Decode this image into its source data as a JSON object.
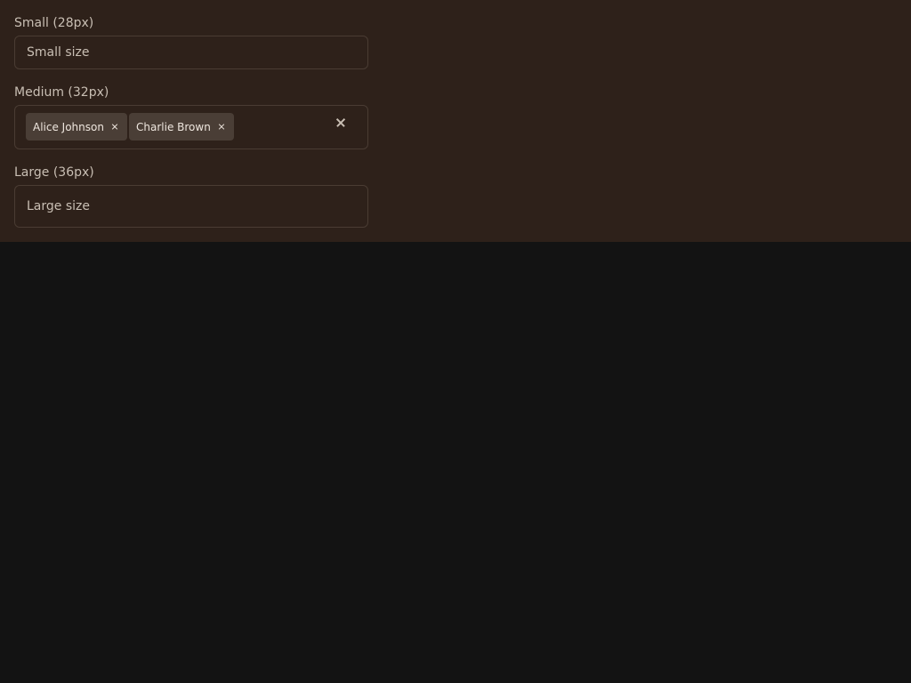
{
  "fields": {
    "small": {
      "label": "Small (28px)",
      "placeholder": "Small size"
    },
    "medium": {
      "label": "Medium (32px)",
      "chips": [
        "Alice Johnson",
        "Charlie Brown"
      ]
    },
    "large": {
      "label": "Large (36px)",
      "placeholder": "Large size"
    }
  },
  "icons": {
    "chip_remove": "close-icon",
    "clear_all": "close-icon"
  },
  "colors": {
    "panel_background": "#2e211a",
    "page_background": "#131313",
    "border": "#4a3c33",
    "chip_background": "#4a3e36",
    "text": "#c9bfb4"
  }
}
